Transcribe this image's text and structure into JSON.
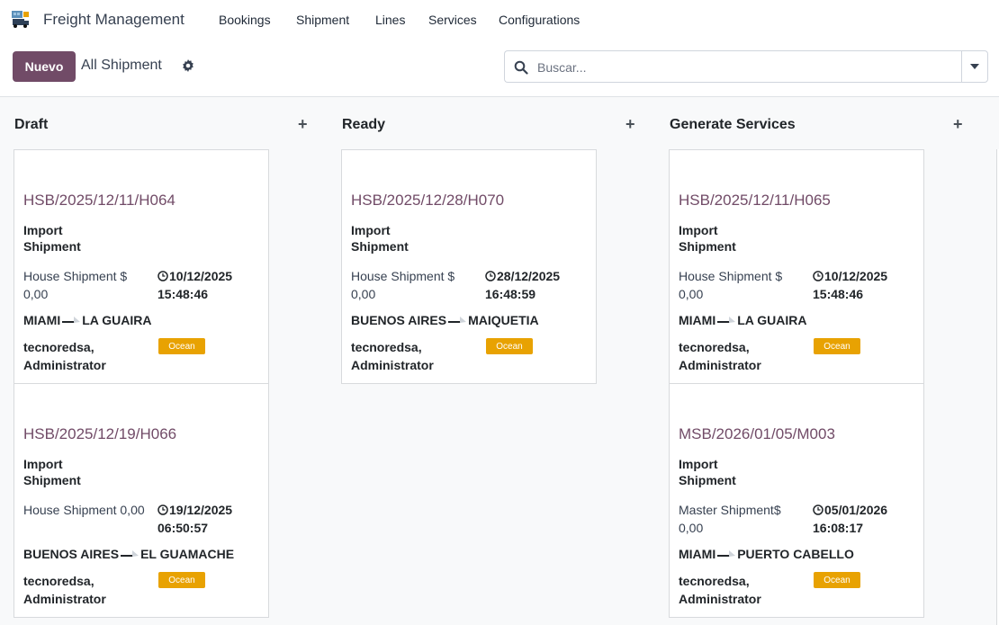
{
  "app": {
    "title": "Freight Management",
    "icon": "freight-truck-icon"
  },
  "menu": [
    "Bookings",
    "Shipment",
    "Lines",
    "Services",
    "Configurations"
  ],
  "controls": {
    "new_label": "Nuevo",
    "breadcrumb": "All Shipment",
    "search_placeholder": "Buscar..."
  },
  "colors": {
    "accent": "#714b67",
    "tag": "#e8a202"
  },
  "columns": [
    {
      "title": "Draft",
      "add": "+"
    },
    {
      "title": "Ready",
      "add": "+"
    },
    {
      "title": "Generate Services",
      "add": "+"
    }
  ],
  "cards": [
    {
      "ref": "HSB/2025/12/11/H064",
      "type": "Import Shipment",
      "kind": "House Shipment $ 0,00",
      "date": "10/12/2025 15:48:46",
      "origin": "MIAMI",
      "dest": "LA GUAIRA",
      "user": "tecnoredsa, Administrator",
      "tag": "Ocean"
    },
    {
      "ref": "HSB/2025/12/19/H066",
      "type": "Import Shipment",
      "kind": "House Shipment 0,00",
      "date": "19/12/2025 06:50:57",
      "origin": "BUENOS AIRES",
      "dest": "EL GUAMACHE",
      "user": "tecnoredsa, Administrator",
      "tag": "Ocean"
    },
    {
      "ref": "HSB/2025/12/28/H070",
      "type": "Import Shipment",
      "kind": "House Shipment $ 0,00",
      "date": "28/12/2025 16:48:59",
      "origin": "BUENOS AIRES",
      "dest": "MAIQUETIA",
      "user": "tecnoredsa, Administrator",
      "tag": "Ocean"
    },
    {
      "ref": "HSB/2025/12/11/H065",
      "type": "Import Shipment",
      "kind": "House Shipment $ 0,00",
      "date": "10/12/2025 15:48:46",
      "origin": "MIAMI",
      "dest": "LA GUAIRA",
      "user": "tecnoredsa, Administrator",
      "tag": "Ocean"
    },
    {
      "ref": "MSB/2026/01/05/M003",
      "type": "Import Shipment",
      "kind": "Master Shipment$ 0,00",
      "date": "05/01/2026 16:08:17",
      "origin": "MIAMI",
      "dest": "PUERTO CABELLO",
      "user": "tecnoredsa, Administrator",
      "tag": "Ocean"
    }
  ]
}
